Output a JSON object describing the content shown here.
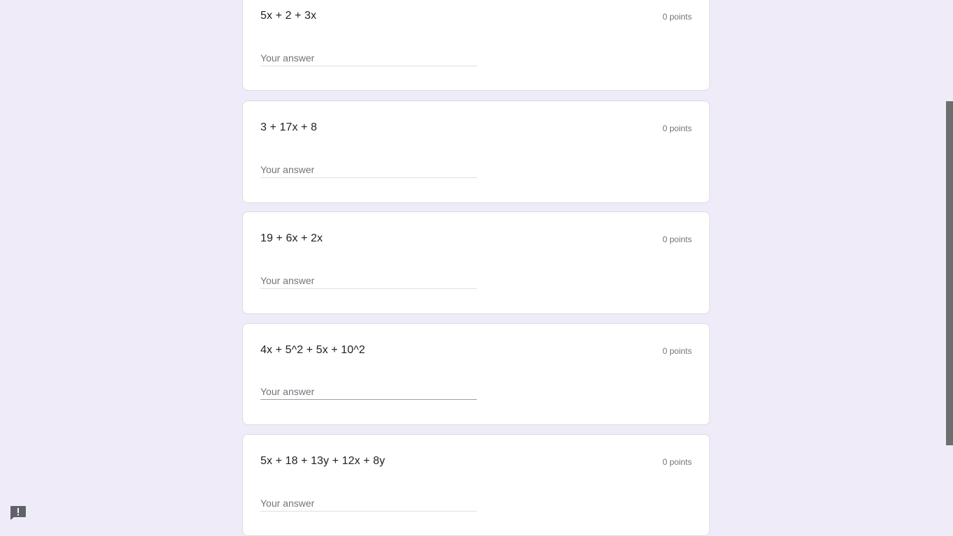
{
  "questions": [
    {
      "title": "5x + 2 + 3x",
      "points": "0 points",
      "placeholder": "Your answer"
    },
    {
      "title": "3 + 17x + 8",
      "points": "0 points",
      "placeholder": "Your answer"
    },
    {
      "title": "19 + 6x + 2x",
      "points": "0 points",
      "placeholder": "Your answer"
    },
    {
      "title": "4x + 5^2 + 5x + 10^2",
      "points": "0 points",
      "placeholder": "Your answer"
    },
    {
      "title": "5x + 18 + 13y + 12x + 8y",
      "points": "0 points",
      "placeholder": "Your answer"
    }
  ],
  "icons": {
    "feedback": "report-feedback-icon"
  },
  "colors": {
    "background": "#efebf8",
    "card": "#ffffff",
    "text": "#202124",
    "muted": "#70757a"
  }
}
